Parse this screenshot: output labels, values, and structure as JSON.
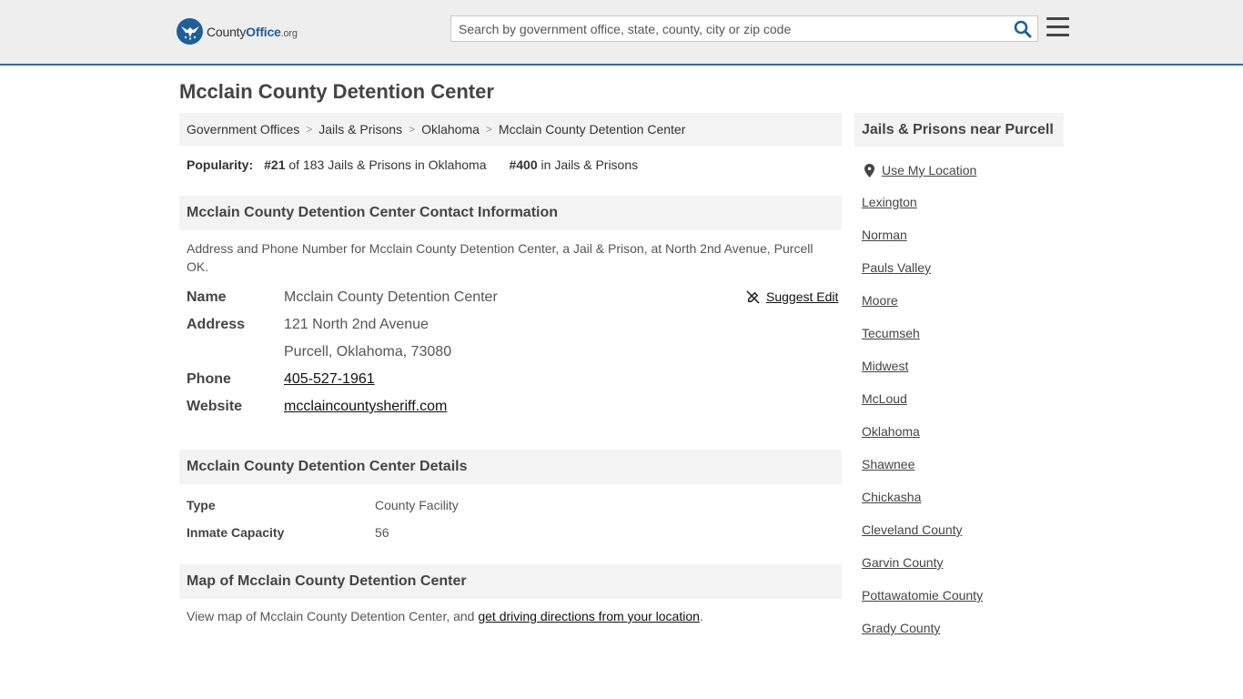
{
  "header": {
    "logo_name": "County",
    "logo_bold": "Office",
    "logo_tld": ".org",
    "search_placeholder": "Search by government office, state, county, city or zip code"
  },
  "page_title": "Mcclain County Detention Center",
  "breadcrumb": [
    "Government Offices",
    "Jails & Prisons",
    "Oklahoma",
    "Mcclain County Detention Center"
  ],
  "popularity": {
    "label": "Popularity:",
    "rank": "#21",
    "rank_text": "of 183 Jails & Prisons in Oklahoma",
    "national_rank": "#400",
    "national_text": "in Jails & Prisons"
  },
  "contact": {
    "heading": "Mcclain County Detention Center Contact Information",
    "description": "Address and Phone Number for Mcclain County Detention Center, a Jail & Prison, at North 2nd Avenue, Purcell OK.",
    "suggest_edit": "Suggest Edit",
    "name_label": "Name",
    "name_value": "Mcclain County Detention Center",
    "address_label": "Address",
    "address_line1": "121 North 2nd Avenue",
    "address_line2": "Purcell, Oklahoma, 73080",
    "phone_label": "Phone",
    "phone_value": "405-527-1961",
    "website_label": "Website",
    "website_value": "mcclaincountysheriff.com"
  },
  "details": {
    "heading": "Mcclain County Detention Center Details",
    "rows": [
      {
        "label": "Type",
        "value": "County Facility"
      },
      {
        "label": "Inmate Capacity",
        "value": "56"
      }
    ]
  },
  "map": {
    "heading": "Map of Mcclain County Detention Center",
    "text_before": "View map of Mcclain County Detention Center, and ",
    "link": "get driving directions from your location",
    "text_after": "."
  },
  "sidebar": {
    "heading": "Jails & Prisons near Purcell",
    "use_location": "Use My Location",
    "items": [
      "Lexington",
      "Norman",
      "Pauls Valley",
      "Moore",
      "Tecumseh",
      "Midwest",
      "McLoud",
      "Oklahoma",
      "Shawnee",
      "Chickasha",
      "Cleveland County",
      "Garvin County",
      "Pottawatomie County",
      "Grady County"
    ]
  },
  "colors": {
    "brand_blue": "#1f5f99",
    "header_bg": "#eeeeee",
    "panel_bg": "#f3f3f3"
  }
}
